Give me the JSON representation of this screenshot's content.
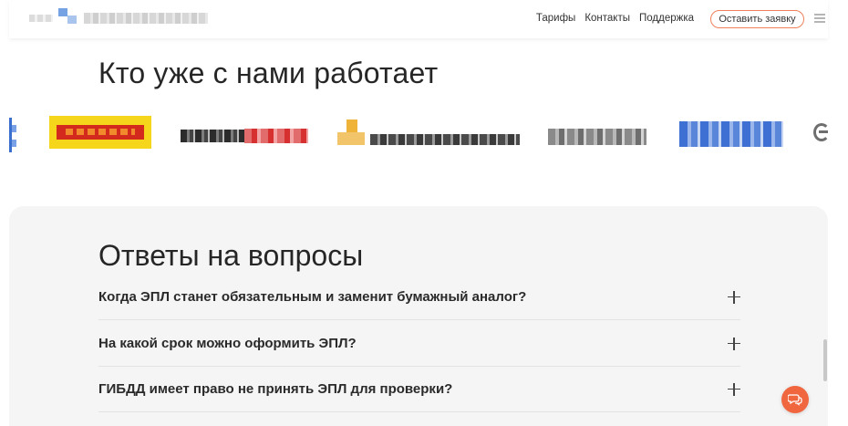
{
  "header": {
    "nav": [
      "Тарифы",
      "Контакты",
      "Поддержка"
    ],
    "cta_label": "Оставить заявку"
  },
  "clients": {
    "title": "Кто уже с нами работает",
    "logos": [
      {
        "name": "logo-partial-left",
        "color": "#3a6fd0"
      },
      {
        "name": "logo-yellow-red",
        "color": "#f2d31c"
      },
      {
        "name": "logo-dark-red",
        "color": "#d83a3a"
      },
      {
        "name": "logo-orange-dark",
        "color": "#f0b33a"
      },
      {
        "name": "logo-grey",
        "color": "#8a8a8a"
      },
      {
        "name": "logo-blue",
        "color": "#3e6fd2"
      },
      {
        "name": "logo-partial-right",
        "color": "#7a7a7a"
      }
    ]
  },
  "faq": {
    "title": "Ответы на вопросы",
    "items": [
      {
        "question": "Когда ЭПЛ станет обязательным и заменит бумажный аналог?"
      },
      {
        "question": "На какой срок можно оформить ЭПЛ?"
      },
      {
        "question": "ГИБДД имеет право не принять ЭПЛ для проверки?"
      }
    ]
  },
  "icons": {
    "menu": "hamburger-icon",
    "expand": "plus-icon",
    "chat": "chat-bubble-icon"
  },
  "colors": {
    "accent": "#f0663f",
    "cta_border": "#f0805b",
    "faq_bg": "#f5f5f5"
  }
}
